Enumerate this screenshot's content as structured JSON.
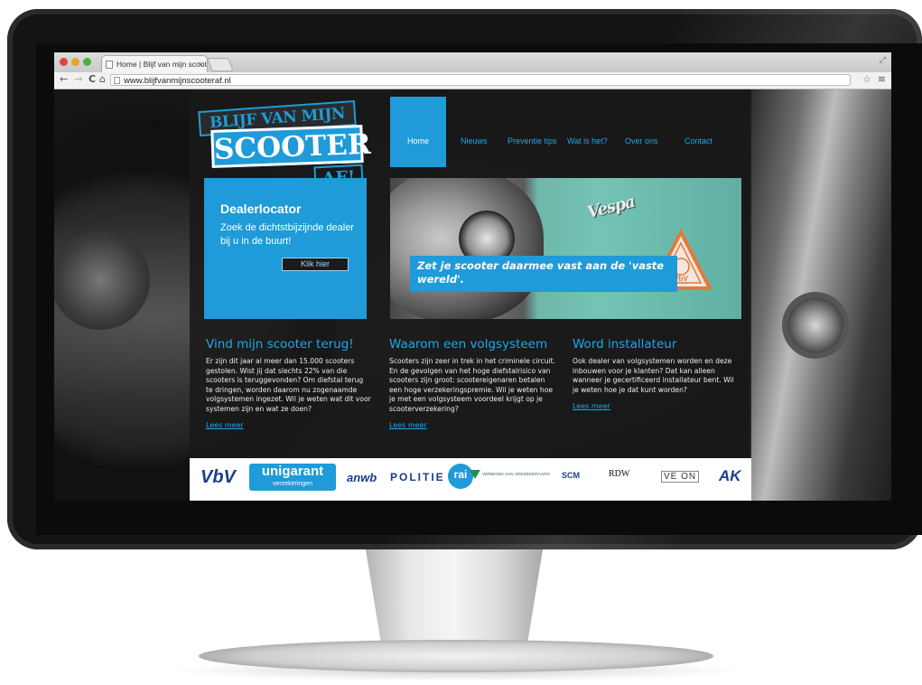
{
  "browser": {
    "tab_title": "Home | Blijf van mijn scoot",
    "tab_close": "×",
    "url": "www.blijfvanmijnscooteraf.nl",
    "back": "←",
    "forward": "→",
    "reload": "C",
    "home": "⌂",
    "star": "☆",
    "menu": "≡",
    "resize": "⤢"
  },
  "logo": {
    "line1": "BLIJF VAN MIJN",
    "line2": "SCOOTER",
    "line3": "AF!"
  },
  "nav": {
    "items": [
      {
        "label": "Home"
      },
      {
        "label": "Nieuws"
      },
      {
        "label": "Preventie tips"
      },
      {
        "label": "Wat is het?"
      },
      {
        "label": "Over ons"
      },
      {
        "label": "Contact"
      }
    ]
  },
  "dealer": {
    "title": "Dealerlocator",
    "text": "Zoek de dichtstbijzijnde dealer bij u in de buurt!",
    "button": "Klik hier"
  },
  "hero": {
    "badge_script": "Vespa",
    "caption": "Zet je scooter daarmee vast aan de 'vaste wereld'.",
    "triangle_label": "VbV"
  },
  "columns": [
    {
      "title": "Vind mijn scooter terug!",
      "text": "Er zijn dit jaar al meer dan 15.000 scooters gestolen. Wist jij dat slechts 22% van die scooters is teruggevonden? Om diefstal terug te dringen, worden daarom nu zogenaamde volgsystemen ingezet. Wil je weten wat dit voor systemen zijn en wat ze doen?",
      "link": "Lees meer"
    },
    {
      "title": "Waarom een volgsysteem",
      "text": "Scooters zijn zeer in trek in het criminele circuit. En de gevolgen van het hoge diefstalrisico van scooters zijn groot: scootereigenaren betalen een hoge verzekeringspremie. Wil je weten hoe je met een volgsysteem voordeel krijgt op je scooterverzekering?",
      "link": "Lees meer"
    },
    {
      "title": "Word installateur",
      "text": "Ook dealer van volgsystemen worden en deze inbouwen voor je klanten? Dat kan alleen wanneer je gecertificeerd installateur bent. Wil je weten hoe je dat kunt worden?",
      "link": "Lees meer"
    }
  ],
  "partners": {
    "vbv": "VbV",
    "unigarant": "unigarant",
    "unigarant_sub": "verzekeringen",
    "anwb": "anwb",
    "politie": "POLITIE",
    "rai": "rai",
    "vvv": "VERBOND VAN VERZEKERAARS",
    "scm": "SCM",
    "rdw": "RDW",
    "vnon": "VE ON",
    "ak": "AK"
  },
  "colors": {
    "accent": "#1e9bd8",
    "link": "#1ea8e8",
    "page_bg": "#191919"
  }
}
